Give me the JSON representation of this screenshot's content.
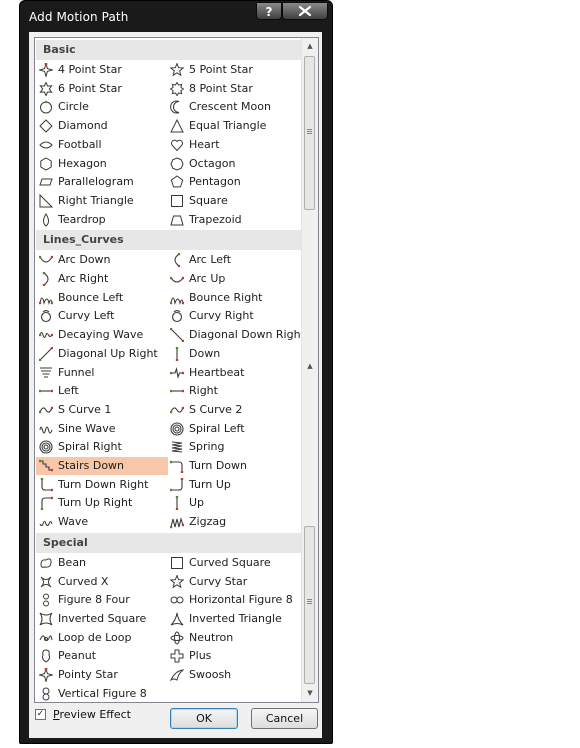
{
  "window": {
    "title": "Add Motion Path",
    "help_label": "?",
    "close_label": "✕"
  },
  "colors": {
    "icon_green": "#4a8a2a",
    "icon_red": "#c0392b",
    "selection": "#f8c6a8"
  },
  "groups": [
    {
      "name": "Basic",
      "items": [
        {
          "label": "4 Point Star",
          "icon": "four-point-star-icon",
          "shape": "star4"
        },
        {
          "label": "5 Point Star",
          "icon": "five-point-star-icon",
          "shape": "star5"
        },
        {
          "label": "6 Point Star",
          "icon": "six-point-star-icon",
          "shape": "star6"
        },
        {
          "label": "8 Point Star",
          "icon": "eight-point-star-icon",
          "shape": "star8"
        },
        {
          "label": "Circle",
          "icon": "circle-icon",
          "shape": "circle"
        },
        {
          "label": "Crescent Moon",
          "icon": "crescent-moon-icon",
          "shape": "moon"
        },
        {
          "label": "Diamond",
          "icon": "diamond-icon",
          "shape": "diamond"
        },
        {
          "label": "Equal Triangle",
          "icon": "equal-triangle-icon",
          "shape": "triangle"
        },
        {
          "label": "Football",
          "icon": "football-icon",
          "shape": "football"
        },
        {
          "label": "Heart",
          "icon": "heart-icon",
          "shape": "heart"
        },
        {
          "label": "Hexagon",
          "icon": "hexagon-icon",
          "shape": "hexagon"
        },
        {
          "label": "Octagon",
          "icon": "octagon-icon",
          "shape": "octagon"
        },
        {
          "label": "Parallelogram",
          "icon": "parallelogram-icon",
          "shape": "parallelogram"
        },
        {
          "label": "Pentagon",
          "icon": "pentagon-icon",
          "shape": "pentagon"
        },
        {
          "label": "Right Triangle",
          "icon": "right-triangle-icon",
          "shape": "righttri"
        },
        {
          "label": "Square",
          "icon": "square-icon",
          "shape": "square"
        },
        {
          "label": "Teardrop",
          "icon": "teardrop-icon",
          "shape": "teardrop"
        },
        {
          "label": "Trapezoid",
          "icon": "trapezoid-icon",
          "shape": "trapezoid"
        }
      ]
    },
    {
      "name": "Lines_Curves",
      "items": [
        {
          "label": "Arc Down",
          "icon": "arc-down-icon",
          "shape": "arcdown"
        },
        {
          "label": "Arc Left",
          "icon": "arc-left-icon",
          "shape": "arcleft"
        },
        {
          "label": "Arc Right",
          "icon": "arc-right-icon",
          "shape": "arcright"
        },
        {
          "label": "Arc Up",
          "icon": "arc-up-icon",
          "shape": "arcup"
        },
        {
          "label": "Bounce Left",
          "icon": "bounce-left-icon",
          "shape": "bounce"
        },
        {
          "label": "Bounce Right",
          "icon": "bounce-right-icon",
          "shape": "bounce2"
        },
        {
          "label": "Curvy Left",
          "icon": "curvy-left-icon",
          "shape": "curvy"
        },
        {
          "label": "Curvy Right",
          "icon": "curvy-right-icon",
          "shape": "curvy"
        },
        {
          "label": "Decaying Wave",
          "icon": "decaying-wave-icon",
          "shape": "wave"
        },
        {
          "label": "Diagonal Down Right",
          "icon": "diagonal-down-right-icon",
          "shape": "diagdown"
        },
        {
          "label": "Diagonal Up Right",
          "icon": "diagonal-up-right-icon",
          "shape": "diagup"
        },
        {
          "label": "Down",
          "icon": "down-icon",
          "shape": "vline"
        },
        {
          "label": "Funnel",
          "icon": "funnel-icon",
          "shape": "funnel"
        },
        {
          "label": "Heartbeat",
          "icon": "heartbeat-icon",
          "shape": "heartbeat"
        },
        {
          "label": "Left",
          "icon": "left-icon",
          "shape": "hline"
        },
        {
          "label": "Right",
          "icon": "right-icon",
          "shape": "hline"
        },
        {
          "label": "S Curve 1",
          "icon": "s-curve-1-icon",
          "shape": "scurve"
        },
        {
          "label": "S Curve 2",
          "icon": "s-curve-2-icon",
          "shape": "scurve"
        },
        {
          "label": "Sine Wave",
          "icon": "sine-wave-icon",
          "shape": "sine"
        },
        {
          "label": "Spiral Left",
          "icon": "spiral-left-icon",
          "shape": "spiral"
        },
        {
          "label": "Spiral Right",
          "icon": "spiral-right-icon",
          "shape": "spiral"
        },
        {
          "label": "Spring",
          "icon": "spring-icon",
          "shape": "spring"
        },
        {
          "label": "Stairs Down",
          "icon": "stairs-down-icon",
          "shape": "stairs",
          "selected": true
        },
        {
          "label": "Turn Down",
          "icon": "turn-down-icon",
          "shape": "turndown"
        },
        {
          "label": "Turn Down Right",
          "icon": "turn-down-right-icon",
          "shape": "turndownright"
        },
        {
          "label": "Turn Up",
          "icon": "turn-up-icon",
          "shape": "turnup"
        },
        {
          "label": "Turn Up Right",
          "icon": "turn-up-right-icon",
          "shape": "turnupright"
        },
        {
          "label": "Up",
          "icon": "up-icon",
          "shape": "vline"
        },
        {
          "label": "Wave",
          "icon": "wave-icon",
          "shape": "smallwave"
        },
        {
          "label": "Zigzag",
          "icon": "zigzag-icon",
          "shape": "zigzag"
        }
      ]
    },
    {
      "name": "Special",
      "items": [
        {
          "label": "Bean",
          "icon": "bean-icon",
          "shape": "bean"
        },
        {
          "label": "Curved Square",
          "icon": "curved-square-icon",
          "shape": "square"
        },
        {
          "label": "Curved X",
          "icon": "curved-x-icon",
          "shape": "curvedx"
        },
        {
          "label": "Curvy Star",
          "icon": "curvy-star-icon",
          "shape": "star5"
        },
        {
          "label": "Figure 8 Four",
          "icon": "figure-8-four-icon",
          "shape": "fig8four"
        },
        {
          "label": "Horizontal Figure 8",
          "icon": "horizontal-figure-8-icon",
          "shape": "hfig8"
        },
        {
          "label": "Inverted Square",
          "icon": "inverted-square-icon",
          "shape": "invsquare"
        },
        {
          "label": "Inverted Triangle",
          "icon": "inverted-triangle-icon",
          "shape": "invtri"
        },
        {
          "label": "Loop de Loop",
          "icon": "loop-de-loop-icon",
          "shape": "loop"
        },
        {
          "label": "Neutron",
          "icon": "neutron-icon",
          "shape": "neutron"
        },
        {
          "label": "Peanut",
          "icon": "peanut-icon",
          "shape": "peanut"
        },
        {
          "label": "Plus",
          "icon": "plus-icon",
          "shape": "plus"
        },
        {
          "label": "Pointy Star",
          "icon": "pointy-star-icon",
          "shape": "star4"
        },
        {
          "label": "Swoosh",
          "icon": "swoosh-icon",
          "shape": "swoosh"
        },
        {
          "label": "Vertical Figure 8",
          "icon": "vertical-figure-8-icon",
          "shape": "vfig8"
        }
      ]
    }
  ],
  "footer": {
    "preview_label_underlined": "P",
    "preview_label_rest": "review Effect",
    "preview_checked": true,
    "preview_check_glyph": "✓",
    "ok_label": "OK",
    "cancel_label": "Cancel"
  },
  "scrollbar": {
    "up_glyph": "▲",
    "down_glyph": "▼",
    "position_fraction": 0.92
  }
}
